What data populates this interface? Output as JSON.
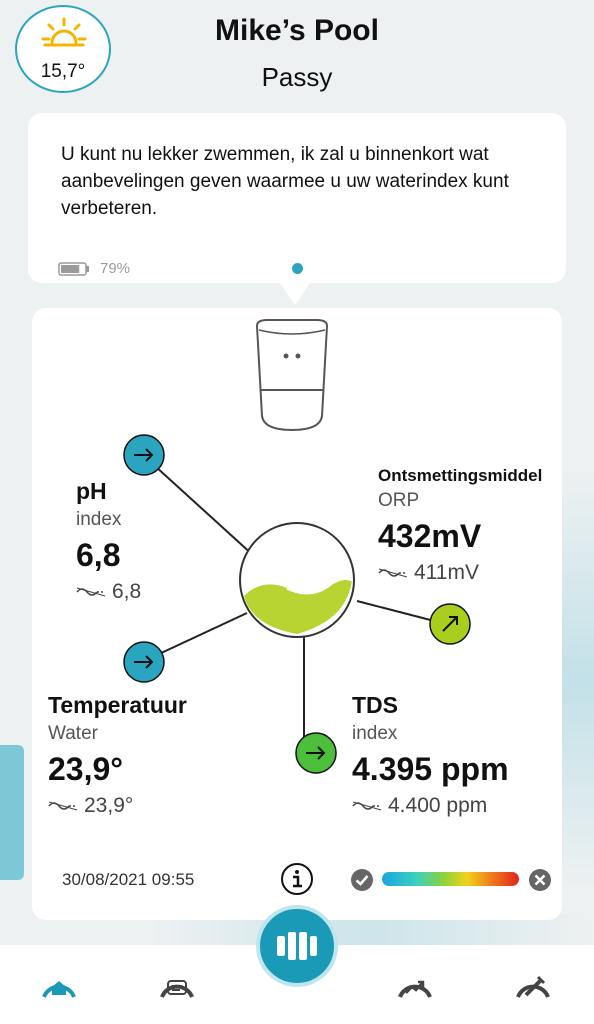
{
  "header": {
    "outdoor_temp": "15,7°",
    "weather_icon": "sun-icon",
    "pool_name": "Mike’s Pool",
    "location": "Passy"
  },
  "message": {
    "text": "U kunt nu lekker zwemmen, ik zal u binnenkort wat aanbevelingen geven waarmee u uw waterindex kunt verbeteren.",
    "battery_label": "79%",
    "battery_level": 0.79
  },
  "metrics": {
    "ph": {
      "title": "pH",
      "sub": "index",
      "value": "6,8",
      "avg": "6,8",
      "status_color": "#2aa5bf",
      "icon": "arrow-right-icon"
    },
    "orp": {
      "title": "Ontsmettingsmiddel",
      "sub": "ORP",
      "value": "432mV",
      "avg": "411mV",
      "status_color": "#8cc63f",
      "icon": "arrow-up-right-icon"
    },
    "temperature": {
      "title": "Temperatuur",
      "sub": "Water",
      "value": "23,9°",
      "avg": "23,9°",
      "status_color": "#2aa5bf",
      "icon": "arrow-right-icon"
    },
    "tds": {
      "title": "TDS",
      "sub": "index",
      "value": "4.395 ppm",
      "avg": "4.400 ppm",
      "status_color": "#4cbf3a",
      "icon": "arrow-right-icon"
    }
  },
  "footer": {
    "timestamp": "30/08/2021 09:55"
  },
  "colors": {
    "accent": "#2aa5bf",
    "water": "#b8d432"
  },
  "nav": {
    "items": [
      "home-icon",
      "chat-icon",
      "pool-device-icon",
      "trend-icon",
      "tools-icon"
    ]
  }
}
